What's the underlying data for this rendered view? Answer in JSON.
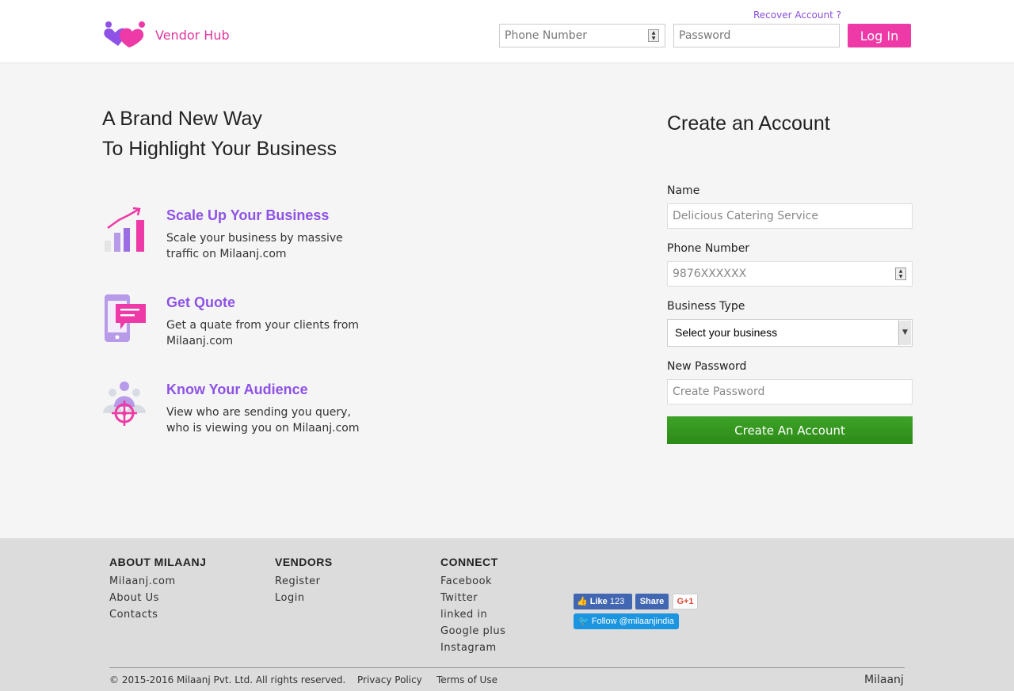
{
  "header": {
    "brand": "Vendor Hub",
    "recover_link": "Recover Account ?",
    "phone_placeholder": "Phone Number",
    "password_placeholder": "Password",
    "login_label": "Log In"
  },
  "hero": {
    "line1": "A Brand New Way",
    "line2": "To Highlight Your Business"
  },
  "features": [
    {
      "title": "Scale Up Your Business",
      "line1": "Scale your business by massive",
      "line2": "traffic on Milaanj.com",
      "icon": "growth-chart-icon"
    },
    {
      "title": "Get Quote",
      "line1": "Get a quate from your clients from",
      "line2": "Milaanj.com",
      "icon": "phone-chat-icon"
    },
    {
      "title": "Know Your Audience",
      "line1": "View who are sending you query,",
      "line2": "who is viewing you on Milaanj.com",
      "icon": "audience-target-icon"
    }
  ],
  "form": {
    "title": "Create an Account",
    "name_label": "Name",
    "name_placeholder": "Delicious Catering Service",
    "phone_label": "Phone Number",
    "phone_placeholder": "9876XXXXXX",
    "business_label": "Business Type",
    "business_selected": "Select your business",
    "password_label": "New Password",
    "password_placeholder": "Create Password",
    "submit_label": "Create An Account"
  },
  "footer": {
    "columns": [
      {
        "heading": "ABOUT MILAANJ",
        "links": [
          "Milaanj.com",
          "About Us",
          "Contacts"
        ]
      },
      {
        "heading": "VENDORS",
        "links": [
          "Register",
          "Login"
        ]
      },
      {
        "heading": "CONNECT",
        "links": [
          "Facebook",
          "Twitter",
          "linked in",
          "Google plus",
          "Instagram"
        ]
      }
    ],
    "social": {
      "fb_like": "Like",
      "fb_count": "123",
      "fb_share": "Share",
      "gplus": "G+1",
      "twitter_follow": "Follow @milaanjindia"
    },
    "copyright": "© 2015-2016 Milaanj Pvt. Ltd. All rights reserved.",
    "privacy": "Privacy Policy",
    "terms": "Terms of Use",
    "brand": "Milaanj"
  },
  "colors": {
    "accent_pink": "#ed3aa6",
    "accent_purple": "#8e52e6",
    "button_green": "#2c8a17"
  }
}
